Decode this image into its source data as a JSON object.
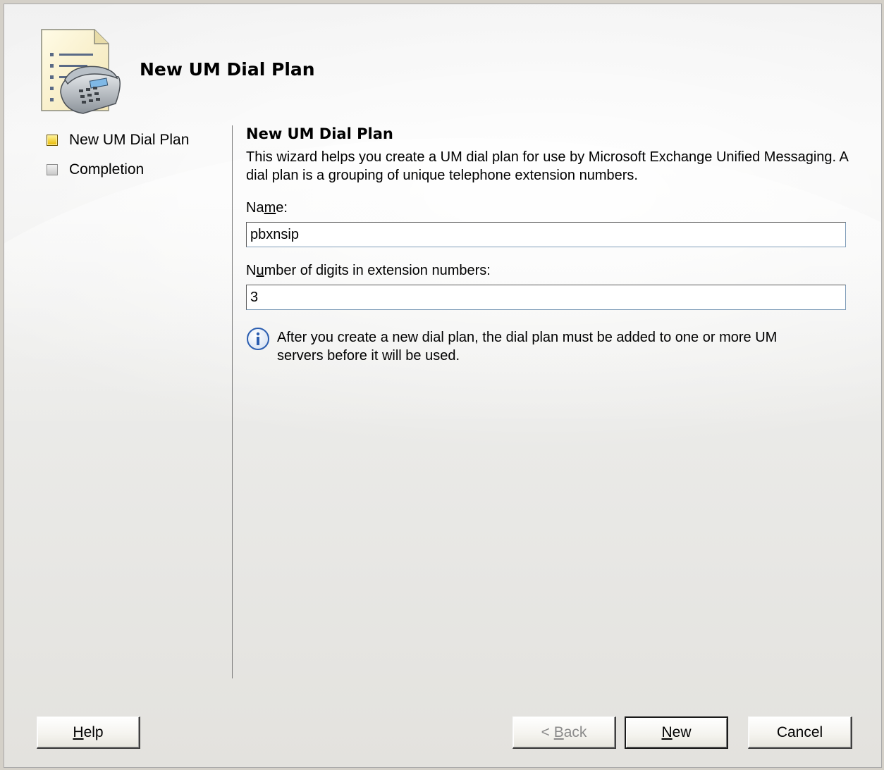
{
  "header": {
    "title": "New UM Dial Plan",
    "icon": "phone-plan-icon"
  },
  "steps": [
    {
      "label": "New UM Dial Plan",
      "state": "active"
    },
    {
      "label": "Completion",
      "state": "inactive"
    }
  ],
  "content": {
    "title": "New UM Dial Plan",
    "description": "This wizard helps you create a UM dial plan for use by Microsoft Exchange Unified Messaging. A dial plan is a grouping of unique telephone extension numbers.",
    "name_field": {
      "label_pre": "Na",
      "label_access": "m",
      "label_post": "e:",
      "value": "pbxnsip"
    },
    "digits_field": {
      "label_pre": "N",
      "label_access": "u",
      "label_post": "mber of digits in extension numbers:",
      "value": "3"
    },
    "info_text": "After you create a new dial plan, the dial plan must be added to one or more UM servers before it will be used."
  },
  "buttons": {
    "help": {
      "access": "H",
      "rest": "elp"
    },
    "back": {
      "pre": "< ",
      "access": "B",
      "rest": "ack",
      "disabled": true
    },
    "new": {
      "access": "N",
      "rest": "ew"
    },
    "cancel": {
      "label": "Cancel"
    }
  },
  "colors": {
    "active_step": "#e8b800",
    "info_icon_blue": "#2a5db0"
  }
}
